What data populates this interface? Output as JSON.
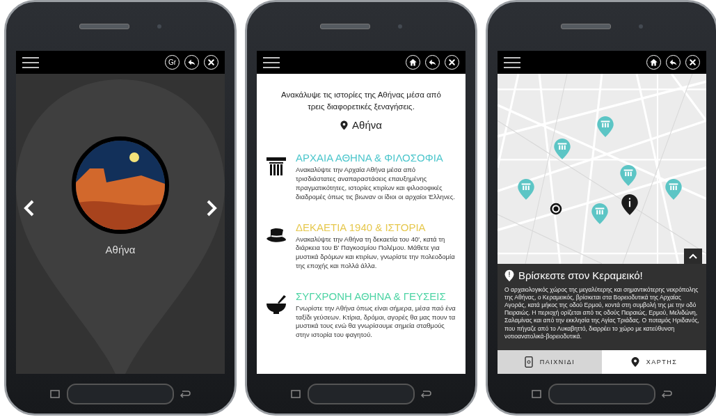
{
  "phones": [
    {
      "kind": "city",
      "top_bar": {
        "buttons": [
          {
            "kind": "lang",
            "label": "Gr"
          },
          {
            "kind": "back"
          },
          {
            "kind": "close"
          }
        ]
      },
      "city": {
        "name": "Αθήνα"
      }
    },
    {
      "kind": "tours",
      "top_bar": {
        "buttons": [
          {
            "kind": "home"
          },
          {
            "kind": "back"
          },
          {
            "kind": "close"
          }
        ]
      },
      "intro": "Ανακάλυψε τις ιστορίες της Αθήνας μέσα από τρεις διαφορετικές ξεναγήσεις.",
      "location": "Αθήνα",
      "tours": [
        {
          "kind": "column",
          "title": "ΑΡΧΑΙΑ ΑΘΗΝΑ & ΦΙΛΟΣΟΦΙΑ",
          "color": "#4cc6cc",
          "description": "Ανακαλύψτε την Αρχαία Αθήνα μέσα από τρισδιάστατες αναπαραστάσεις επαυξημένης πραγματικότητες, ιστορίες κτιρίων και φιλοσοφικές διαδρομές όπως τις βιωναν οι ίδιοι οι αρχαίοι Έλληνες."
        },
        {
          "kind": "hat",
          "title": "ΔΕΚΑΕΤΙΑ 1940 & ΙΣΤΟΡΙΑ",
          "color": "#e6c84e",
          "description": "Ανακαλύψτε την Αθήνα τη δεκαετία του 40', κατά τη διάρκεια του Β' Παγκοσμίου Πολέμου. Μάθετε για μυστικά δρόμων και κτιρίων, γνωρίστε την πολεοδομία της εποχής και πολλά άλλα."
        },
        {
          "kind": "mortar",
          "title": "ΣΥΓΧΡΟΝΗ ΑΘΗΝΑ & ΓΕΥΣΕΙΣ",
          "color": "#4dd4a4",
          "description": "Γνωρίστε την Αθήνα όπως είναι σήμερα, μέσα παό ένα ταξίδι γεύσεων. Κτίρια, δρόμοι, αγορές θα μας πουν τα μυστικά τους ενώ θα γνωρίσουμε σημεία σταθμούς στην ιστορία του φαγητού."
        }
      ]
    },
    {
      "kind": "map",
      "top_bar": {
        "buttons": [
          {
            "kind": "home"
          },
          {
            "kind": "back"
          },
          {
            "kind": "close"
          }
        ]
      },
      "info": {
        "title": "Βρίσκεστε στον Κεραμεικό!",
        "text": "Ο αρχαιολογικός χώρος της μεγαλύτερης και σημαντικότερης νεκρόπολης της Αθήνας, ο Κεραμεικός, βρίσκεται στα Βορειοδυτικά της Αρχαίας Αγοράς, κατά μήκος της οδού Ερμού, κοντά στη συμβολή της με την οδό Πειραιώς. Η περιοχή ορίζεται από τις οδούς Πειραιώς, Ερμού, Μελιδώνη, Σαλαμίνας και από την εκκλησία της Αγίας Τριάδας. Ο ποταμός Ηριδανός, που πήγαζε από το Λυκαβηττό, διαρρέει το χώρο με κατεύθυνση νοτιοανατολικά-βορειοδυτικά."
      },
      "tabs": [
        {
          "kind": "game",
          "label": "ΠΑΙΧΝΙΔΙ",
          "selected": false
        },
        {
          "kind": "map",
          "label": "ΧΑΡΤΗΣ",
          "selected": true
        }
      ]
    }
  ]
}
